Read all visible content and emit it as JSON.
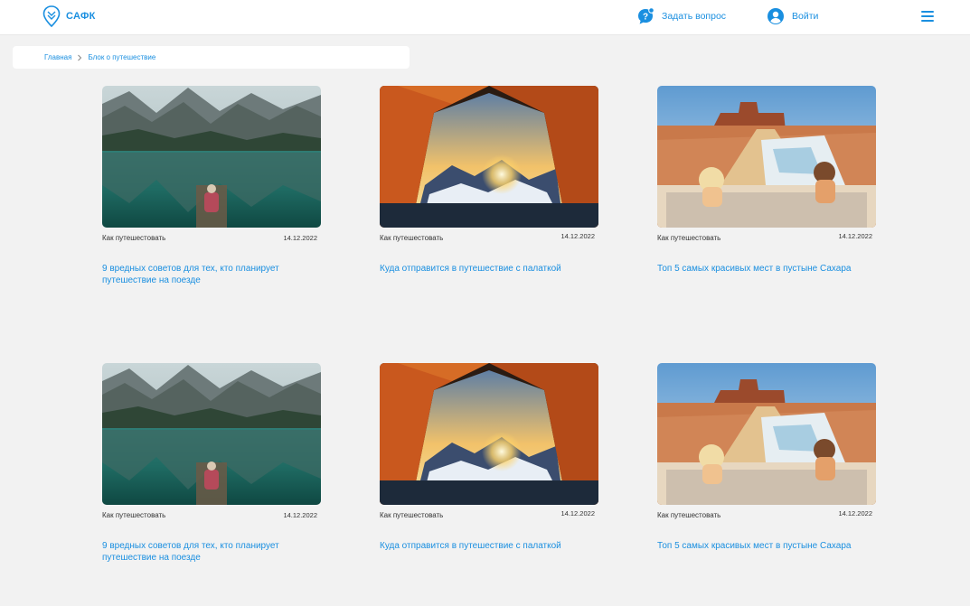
{
  "header": {
    "logo_text": "САФК",
    "ask_label": "Задать вопрос",
    "login_label": "Войти",
    "accent_color": "#1a8fe0"
  },
  "breadcrumb": {
    "items": [
      "Главная",
      "Блок о путешествие"
    ]
  },
  "cards": [
    {
      "image": "lake-mountains-reflection",
      "category": "Как путешестовать",
      "date": "14.12.2022",
      "title": "9 вредных советов для тех, кто планирует путешествие на поезде"
    },
    {
      "image": "tent-sunset-mountains",
      "category": "Как путешестовать",
      "date": "14.12.2022",
      "title": "Куда отправится в путешествие с палаткой"
    },
    {
      "image": "desert-convertible-map",
      "category": "Как путешестовать",
      "date": "14.12.2022",
      "title": "Топ 5 самых красивых мест в пустыне Сахара"
    },
    {
      "image": "lake-mountains-reflection",
      "category": "Как путешестовать",
      "date": "14.12.2022",
      "title": "9 вредных советов для тех, кто планирует путешествие на поезде"
    },
    {
      "image": "tent-sunset-mountains",
      "category": "Как путешестовать",
      "date": "14.12.2022",
      "title": "Куда отправится в путешествие с палаткой"
    },
    {
      "image": "desert-convertible-map",
      "category": "Как путешестовать",
      "date": "14.12.2022",
      "title": "Топ 5 самых красивых мест в пустыне Сахара"
    }
  ]
}
